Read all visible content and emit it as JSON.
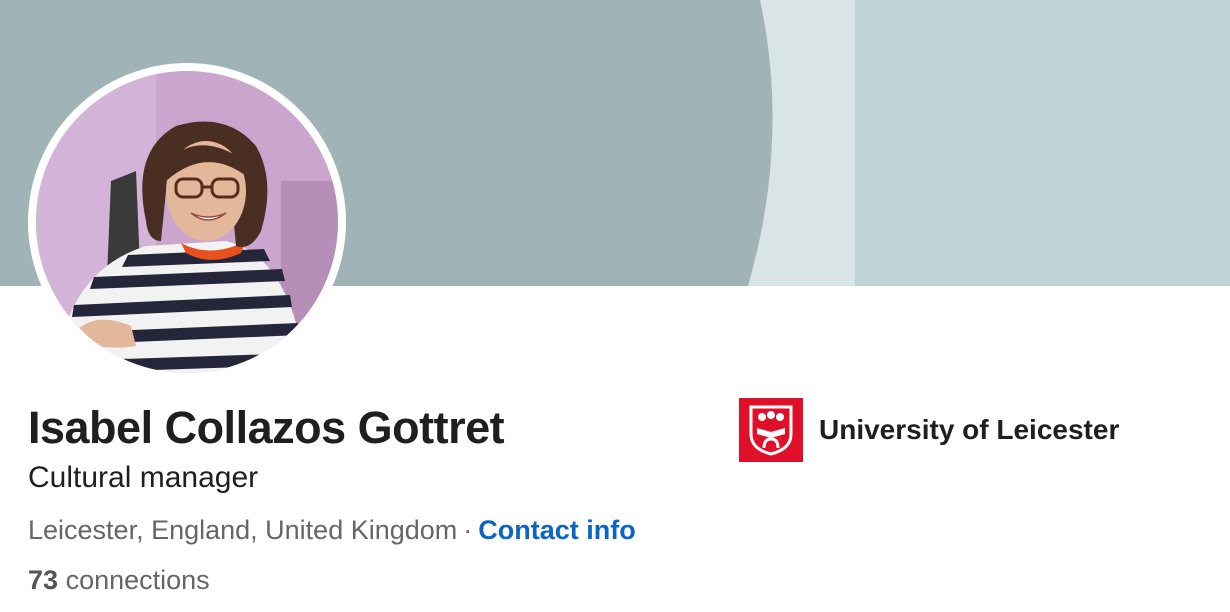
{
  "profile": {
    "name": "Isabel Collazos Gottret",
    "headline": "Cultural manager",
    "location": "Leicester, England, United Kingdom",
    "separator": "·",
    "contact_info_label": "Contact info",
    "connections_count": "73",
    "connections_label": "connections"
  },
  "education": {
    "school_name": "University of Leicester",
    "logo_icon": "university-crest-icon"
  },
  "colors": {
    "banner_dark": "#a0b3b6",
    "banner_light": "#bfd3d7",
    "banner_stripe": "#d8e4e6",
    "link": "#0a66c2",
    "logo_red": "#e1102a"
  }
}
